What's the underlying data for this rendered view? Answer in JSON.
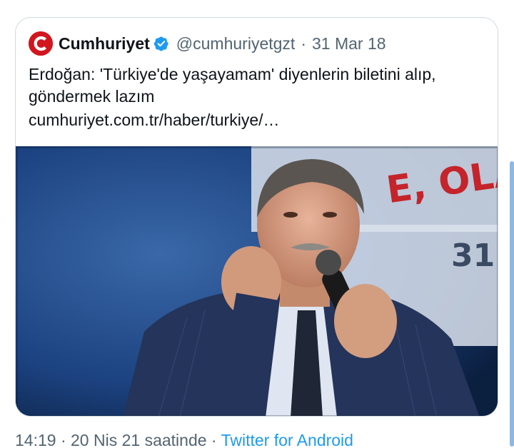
{
  "tweet": {
    "source_logo_icon": "cumhuriyet-logo-icon",
    "display_name": "Cumhuriyet",
    "verified_icon": "verified-badge-icon",
    "handle": "@cumhuriyetgzt",
    "separator": "·",
    "date": "31 Mar 18",
    "headline": "Erdoğan: 'Türkiye'de yaşayamam' diyenlerin biletini alıp, göndermek lazım",
    "link": "cumhuriyet.com.tr/haber/turkiye/…",
    "image": {
      "banner_text": "E, OLAC",
      "banner_number": "31"
    }
  },
  "meta": {
    "time": "14:19",
    "separator1": "·",
    "date": "20 Nis 21 saatinde",
    "separator2": "·",
    "client": "Twitter for Android"
  },
  "colors": {
    "verified_blue": "#1d9bf0",
    "brand_red": "#d3161e",
    "link_blue": "#1d9bf0"
  }
}
